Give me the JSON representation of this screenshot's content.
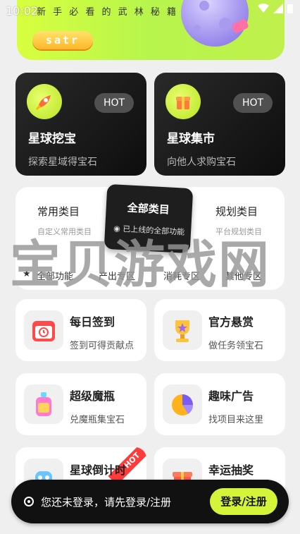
{
  "status_bar": {
    "time": "10:02"
  },
  "banner": {
    "title": "新 手 必 看 的 武 林 秘 籍",
    "button_label": "satr"
  },
  "dark_cards": [
    {
      "title": "星球挖宝",
      "subtitle": "探索星域得宝石",
      "badge": "HOT"
    },
    {
      "title": "星球集市",
      "subtitle": "向他人求购宝石",
      "badge": "HOT"
    }
  ],
  "categories": {
    "left": {
      "label": "常用类目",
      "sub": "自定义常用类目"
    },
    "center": {
      "label": "全部类目",
      "sub": "已上线的全部功能"
    },
    "right": {
      "label": "规划类目",
      "sub": "平台规划类目"
    },
    "row": [
      "全部功能",
      "产出专区",
      "消耗专区",
      "其他专区"
    ]
  },
  "watermark": "宝贝游戏网",
  "features": [
    {
      "title": "每日签到",
      "subtitle": "签到可得贡献点",
      "icon": "calendar-icon"
    },
    {
      "title": "官方悬赏",
      "subtitle": "做任务领宝石",
      "icon": "trophy-icon"
    },
    {
      "title": "超级魔瓶",
      "subtitle": "兑魔瓶集宝石",
      "icon": "bottle-icon"
    },
    {
      "title": "趣味广告",
      "subtitle": "找项目来这里",
      "icon": "pie-chart-icon"
    },
    {
      "title": "星球倒计时",
      "subtitle": "",
      "icon": "robot-icon",
      "badge": "HOT"
    },
    {
      "title": "幸运抽奖",
      "subtitle": "",
      "icon": "gift-icon"
    }
  ],
  "login": {
    "message": "您还未登录，请先登录/注册",
    "button_label": "登录/注册"
  },
  "colors": {
    "accent": "#d4f43a",
    "dark": "#111111",
    "hot_badge": "#ff3b3b"
  }
}
